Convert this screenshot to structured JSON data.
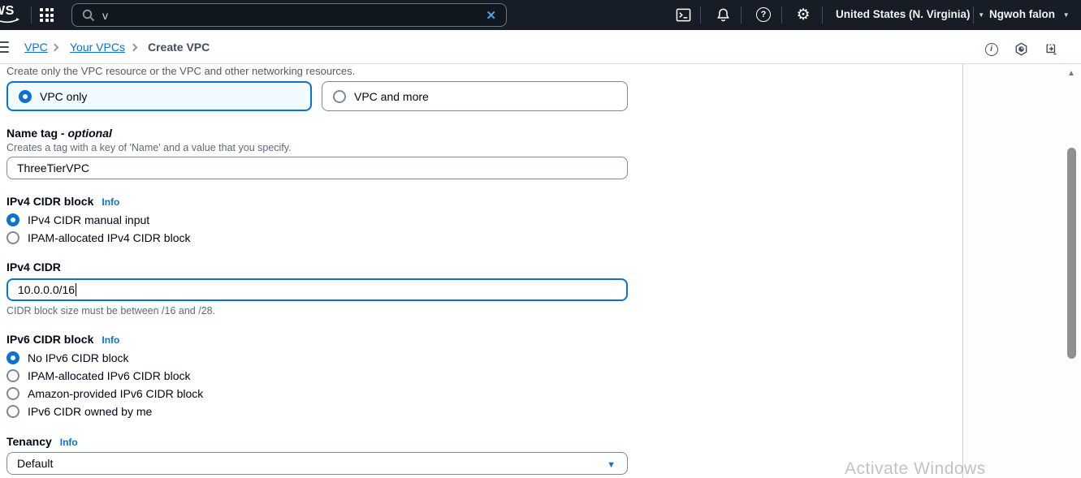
{
  "topbar": {
    "logo_visible": "WS",
    "search": {
      "value": "v"
    },
    "region_label": "United States (N. Virginia)",
    "user_label": "Ngwoh falon"
  },
  "breadcrumb": {
    "items": [
      "VPC",
      "Your VPCs",
      "Create VPC"
    ]
  },
  "form": {
    "resources_desc": "Create only the VPC resource or the VPC and other networking resources.",
    "tiles": [
      {
        "label": "VPC only",
        "selected": true
      },
      {
        "label": "VPC and more",
        "selected": false
      }
    ],
    "name_tag": {
      "label": "Name tag",
      "optional_suffix": "- optional",
      "desc": "Creates a tag with a key of 'Name' and a value that you specify.",
      "value": "ThreeTierVPC"
    },
    "ipv4_block": {
      "label": "IPv4 CIDR block",
      "info": "Info",
      "options": [
        "IPv4 CIDR manual input",
        "IPAM-allocated IPv4 CIDR block"
      ],
      "selected_index": 0
    },
    "ipv4_cidr": {
      "label": "IPv4 CIDR",
      "value": "10.0.0.0/16",
      "constraint": "CIDR block size must be between /16 and /28."
    },
    "ipv6_block": {
      "label": "IPv6 CIDR block",
      "info": "Info",
      "options": [
        "No IPv6 CIDR block",
        "IPAM-allocated IPv6 CIDR block",
        "Amazon-provided IPv6 CIDR block",
        "IPv6 CIDR owned by me"
      ],
      "selected_index": 0
    },
    "tenancy": {
      "label": "Tenancy",
      "info": "Info",
      "value": "Default"
    }
  },
  "watermark": "Activate Windows",
  "icons": {
    "search": "magnifier",
    "clear": "✕",
    "apps": "3x3-grid",
    "cloudshell": "terminal",
    "notifications": "bell",
    "help": "?",
    "settings": "gear",
    "caret": "▼",
    "scroll_up": "▲"
  },
  "colors": {
    "accent": "#0972d3",
    "header_bg": "#161d26",
    "selected_tile_bg": "#f1faff",
    "link": "#0972d3",
    "clear_x": "#539fe5",
    "divider": "#d5dbdb"
  }
}
